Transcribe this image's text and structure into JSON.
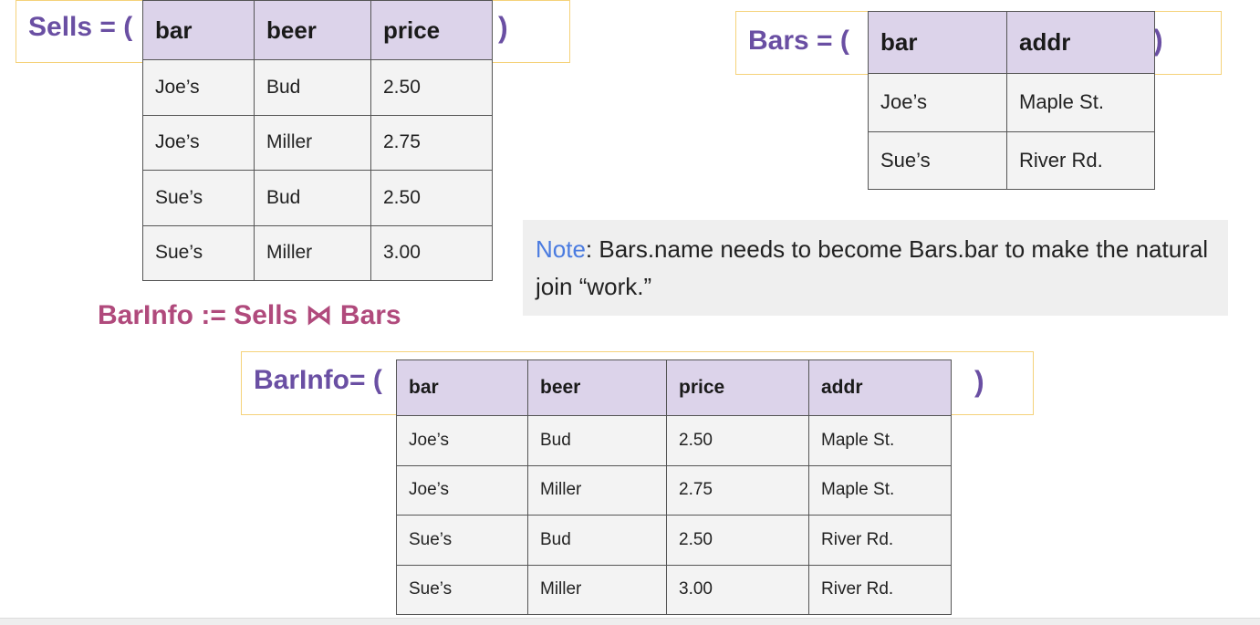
{
  "sells": {
    "label": "Sells = (",
    "close": ")",
    "headers": [
      "bar",
      "beer",
      "price"
    ],
    "rows": [
      [
        "Joe’s",
        "Bud",
        "2.50"
      ],
      [
        "Joe’s",
        "Miller",
        "2.75"
      ],
      [
        "Sue’s",
        "Bud",
        "2.50"
      ],
      [
        "Sue’s",
        "Miller",
        "3.00"
      ]
    ]
  },
  "bars": {
    "label": "Bars = (",
    "close": ")",
    "headers": [
      "bar",
      "addr"
    ],
    "rows": [
      [
        "Joe’s",
        "Maple St."
      ],
      [
        "Sue’s",
        "River Rd."
      ]
    ]
  },
  "note": {
    "label": "Note",
    "text": ": Bars.name needs to become Bars.bar to make the natural join “work.”"
  },
  "formula": "BarInfo := Sells ⋈ Bars",
  "barinfo": {
    "label": "BarInfo= (",
    "close": ")",
    "headers": [
      "bar",
      "beer",
      "price",
      "addr"
    ],
    "rows": [
      [
        "Joe’s",
        "Bud",
        "2.50",
        "Maple St."
      ],
      [
        "Joe’s",
        "Miller",
        "2.75",
        "Maple St."
      ],
      [
        "Sue’s",
        "Bud",
        "2.50",
        "River Rd."
      ],
      [
        "Sue’s",
        "Miller",
        "3.00",
        "River Rd."
      ]
    ]
  },
  "colors": {
    "header_bg": "#dcd3ea",
    "cell_bg": "#f3f3f3",
    "frame_border": "#f5d27a",
    "relation_label": "#6a4fa3",
    "formula": "#b04a7c",
    "note_label": "#4a7be0"
  }
}
